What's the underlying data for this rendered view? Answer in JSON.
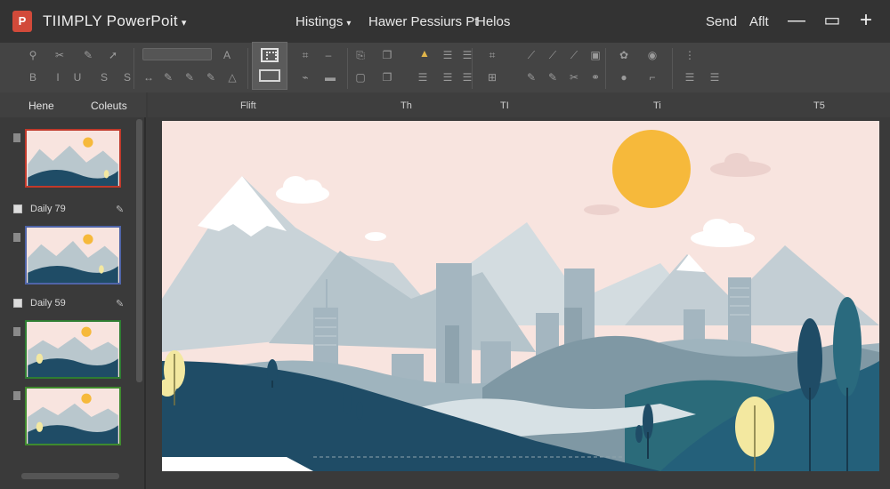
{
  "app": {
    "logo_letter": "P",
    "title": "TIIMPLY  PowerPoit",
    "caret": "▾"
  },
  "menu": {
    "item1": "Histings",
    "item1_caret": "▾",
    "item2": "Hawer Pessiurs Pt",
    "item3": "Helos"
  },
  "titlebar_right": {
    "send": "Send",
    "aft": "Aflt",
    "minimize_glyph": "—",
    "restore_glyph": "▭",
    "add_glyph": "+"
  },
  "left_panel": {
    "tab_home": "Hene",
    "tab_colours": "Coleuts",
    "slide_label_1": "Daily 79",
    "slide_label_2": "Daily 59"
  },
  "ruler": {
    "label_left": "Flift",
    "tick_1": "Th",
    "tick_2": "TI",
    "tick_3": "Ti",
    "tick_4": "T5"
  },
  "colors": {
    "sky": "#f8e4df",
    "sun": "#f6b93b",
    "mountain_far": "#c7d1d6",
    "mountain_mid": "#a9b9c1",
    "building": "#9fb3be",
    "hill_dark": "#1f4c66",
    "hill_teal": "#2b6b7a",
    "tree_yellow": "#f3e8a0",
    "thumb_border_1": "#c0392b",
    "thumb_border_2": "#4f64a8",
    "thumb_border_3": "#2e7d32",
    "thumb_border_4": "#3f8a2e"
  }
}
